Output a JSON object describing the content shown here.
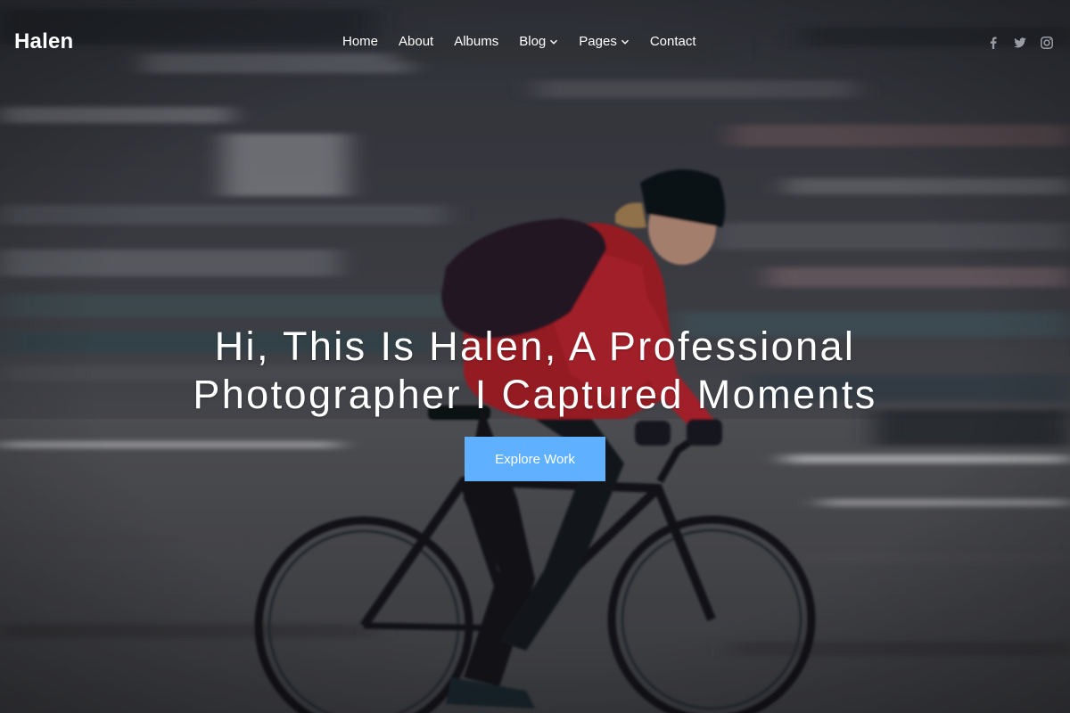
{
  "brand": {
    "logo": "Halen"
  },
  "nav": {
    "items": [
      {
        "label": "Home",
        "dropdown": false
      },
      {
        "label": "About",
        "dropdown": false
      },
      {
        "label": "Albums",
        "dropdown": false
      },
      {
        "label": "Blog",
        "dropdown": true
      },
      {
        "label": "Pages",
        "dropdown": true
      },
      {
        "label": "Contact",
        "dropdown": false
      }
    ]
  },
  "social": [
    {
      "icon": "facebook-icon"
    },
    {
      "icon": "twitter-icon"
    },
    {
      "icon": "instagram-icon"
    }
  ],
  "hero": {
    "headline_line1": "Hi, This Is Halen, A Professional",
    "headline_line2": "Photographer I Captured Moments",
    "cta_label": "Explore Work",
    "background_image": "blurred-city-cyclist-photo"
  },
  "colors": {
    "accent": "#5fb1ff",
    "text": "#ffffff",
    "social_icon": "#9a9ca3"
  }
}
